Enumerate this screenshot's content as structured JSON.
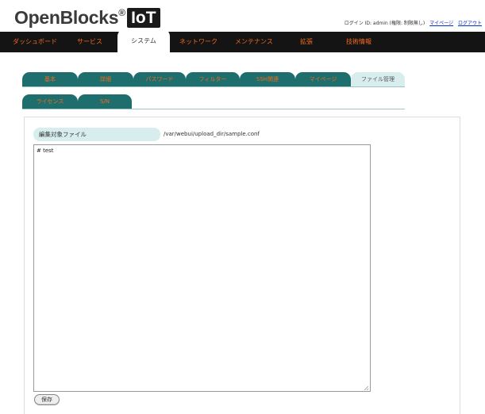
{
  "logo": {
    "text": "OpenBlocks",
    "reg": "®",
    "badge": "IoT"
  },
  "userbar": {
    "login_info": "ログイン ID: admin (権限: 制限無し)",
    "mypage_link": "マイページ",
    "logout_link": "ログアウト"
  },
  "mainnav": {
    "items": [
      {
        "label": "ダッシュボード"
      },
      {
        "label": "サービス"
      },
      {
        "label": "システム"
      },
      {
        "label": "ネットワーク"
      },
      {
        "label": "メンテナンス"
      },
      {
        "label": "拡張"
      },
      {
        "label": "技術情報"
      }
    ],
    "active": "システム"
  },
  "subtabs": {
    "row1": [
      {
        "label": "基本"
      },
      {
        "label": "詳細"
      },
      {
        "label": "パスワード"
      },
      {
        "label": "フィルター"
      },
      {
        "label": "SSH関連"
      },
      {
        "label": "マイページ"
      },
      {
        "label": "ファイル管理"
      }
    ],
    "row2": [
      {
        "label": "ライセンス"
      },
      {
        "label": "S/N"
      }
    ],
    "active": "ファイル管理"
  },
  "editor": {
    "label": "編集対象ファイル",
    "path": "/var/webui/upload_dir/sample.conf",
    "content": "# test",
    "save_label": "保存"
  },
  "colors": {
    "nav_bg": "#141414",
    "nav_text": "#f26a1b",
    "tab_bg": "#1f6e6e",
    "tab_active_bg": "#d8eeee",
    "link": "#0033cc"
  }
}
